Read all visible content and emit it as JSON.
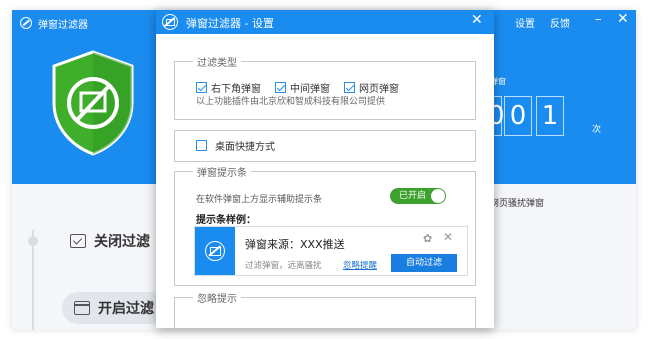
{
  "main_window": {
    "app_name": "弹窗过滤器",
    "titlebar": {
      "settings": "设置",
      "feedback": "反馈",
      "minimize": "–",
      "close": "✕"
    },
    "counter": {
      "label": "弹窗",
      "digits": [
        "0",
        "0",
        "1"
      ],
      "unit": "次"
    },
    "lower_text": "网页骚扰弹窗",
    "rows": {
      "close_filter": "关闭过滤",
      "open_filter": "开启过滤"
    }
  },
  "dialog": {
    "title": "弹窗过滤器 - 设置",
    "close": "✕",
    "filter_type": {
      "legend": "过滤类型",
      "options": [
        {
          "label": "右下角弹窗",
          "checked": true
        },
        {
          "label": "中间弹窗",
          "checked": true
        },
        {
          "label": "网页弹窗",
          "checked": true
        }
      ],
      "description": "以上功能插件由北京欣和智成科技有限公司提供"
    },
    "desktop_shortcut": {
      "label": "桌面快捷方式",
      "checked": false
    },
    "tip_bar": {
      "legend": "弹窗提示条",
      "description": "在软件弹窗上方显示辅助提示条",
      "toggle_label": "已开启",
      "sample_label": "提示条样例：",
      "sample": {
        "title": "弹窗来源：XXX推送",
        "subtitle": "过滤弹窗，远离骚扰",
        "ignore_link": "忽略提醒",
        "filter_button": "自动过滤",
        "gear": "✿",
        "close": "✕"
      }
    },
    "ignore_tips": {
      "legend": "忽略提示"
    }
  }
}
